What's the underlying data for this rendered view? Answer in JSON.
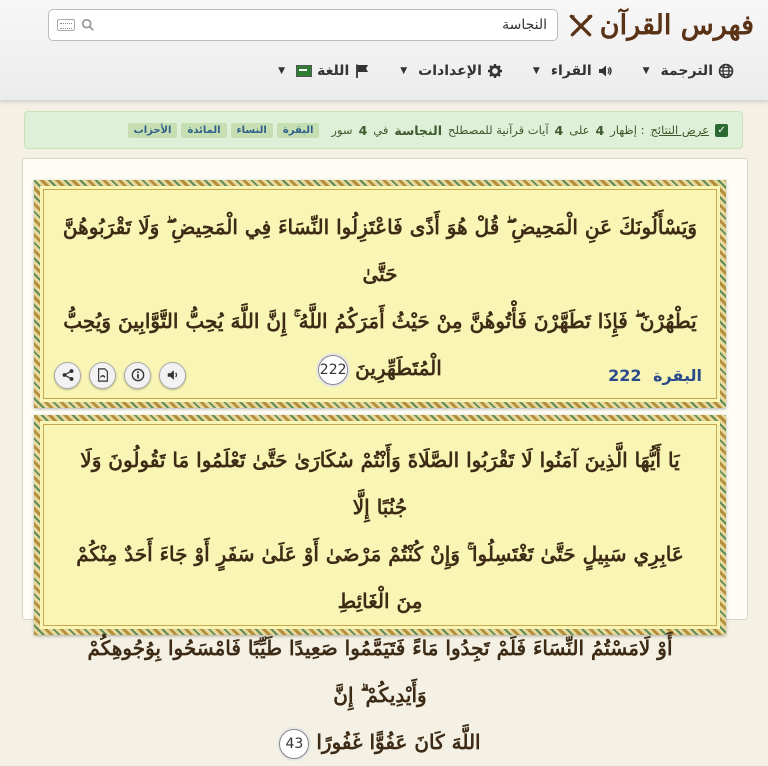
{
  "header": {
    "logo_text": "فهرس القرآن",
    "search": {
      "value": "النجاسة",
      "placeholder": ""
    },
    "nav": [
      {
        "label": "الترجمة",
        "icon": "globe-icon"
      },
      {
        "label": "القراء",
        "icon": "speaker-icon"
      },
      {
        "label": "الإعدادات",
        "icon": "gear-icon"
      },
      {
        "label": "اللغة",
        "icon": "flag-icon"
      }
    ]
  },
  "alert": {
    "show_results_link": "عرض النتائج",
    "text_prefix": ": إظهار",
    "count_shown": "4",
    "text_of": "على",
    "count_total": "4",
    "text_mid": "آيات قرآنية للمصطلح",
    "term": "النجاسة",
    "text_in": "في",
    "surah_count": "4",
    "text_suras": "سور",
    "tags": [
      "البقرة",
      "النساء",
      "المائدة",
      "الأحزاب"
    ]
  },
  "results": [
    {
      "lines": [
        "وَيَسْأَلُونَكَ عَنِ الْمَحِيضِ ۖ قُلْ هُوَ أَذًى فَاعْتَزِلُوا النِّسَاءَ فِي الْمَحِيضِ ۖ وَلَا تَقْرَبُوهُنَّ حَتَّىٰ",
        "يَطْهُرْنَ ۖ فَإِذَا تَطَهَّرْنَ فَأْتُوهُنَّ مِنْ حَيْثُ أَمَرَكُمُ اللَّهُ ۚ إِنَّ اللَّهَ يُحِبُّ التَّوَّابِينَ وَيُحِبُّ",
        "الْمُتَطَهِّرِينَ"
      ],
      "ayah_number": "222",
      "surah_name": "البقرة",
      "ref_number": "222"
    },
    {
      "lines": [
        "يَا أَيُّهَا الَّذِينَ آمَنُوا لَا تَقْرَبُوا الصَّلَاةَ وَأَنْتُمْ سُكَارَىٰ حَتَّىٰ تَعْلَمُوا مَا تَقُولُونَ وَلَا جُنُبًا إِلَّا",
        "عَابِرِي سَبِيلٍ حَتَّىٰ تَغْتَسِلُوا ۚ وَإِنْ كُنْتُمْ مَرْضَىٰ أَوْ عَلَىٰ سَفَرٍ أَوْ جَاءَ أَحَدٌ مِنْكُمْ مِنَ الْغَائِطِ",
        "أَوْ لَامَسْتُمُ النِّسَاءَ فَلَمْ تَجِدُوا مَاءً فَتَيَمَّمُوا صَعِيدًا طَيِّبًا فَامْسَحُوا بِوُجُوهِكُمْ وَأَيْدِيكُمْ ۗ إِنَّ",
        "اللَّهَ كَانَ عَفُوًّا غَفُورًا"
      ],
      "ayah_number": "43"
    }
  ],
  "colors": {
    "card_bg": "#f9f5b5",
    "ref_blue": "#2b4b8c",
    "alert_bg": "#dff0d8",
    "brand_brown": "#5a3216"
  }
}
